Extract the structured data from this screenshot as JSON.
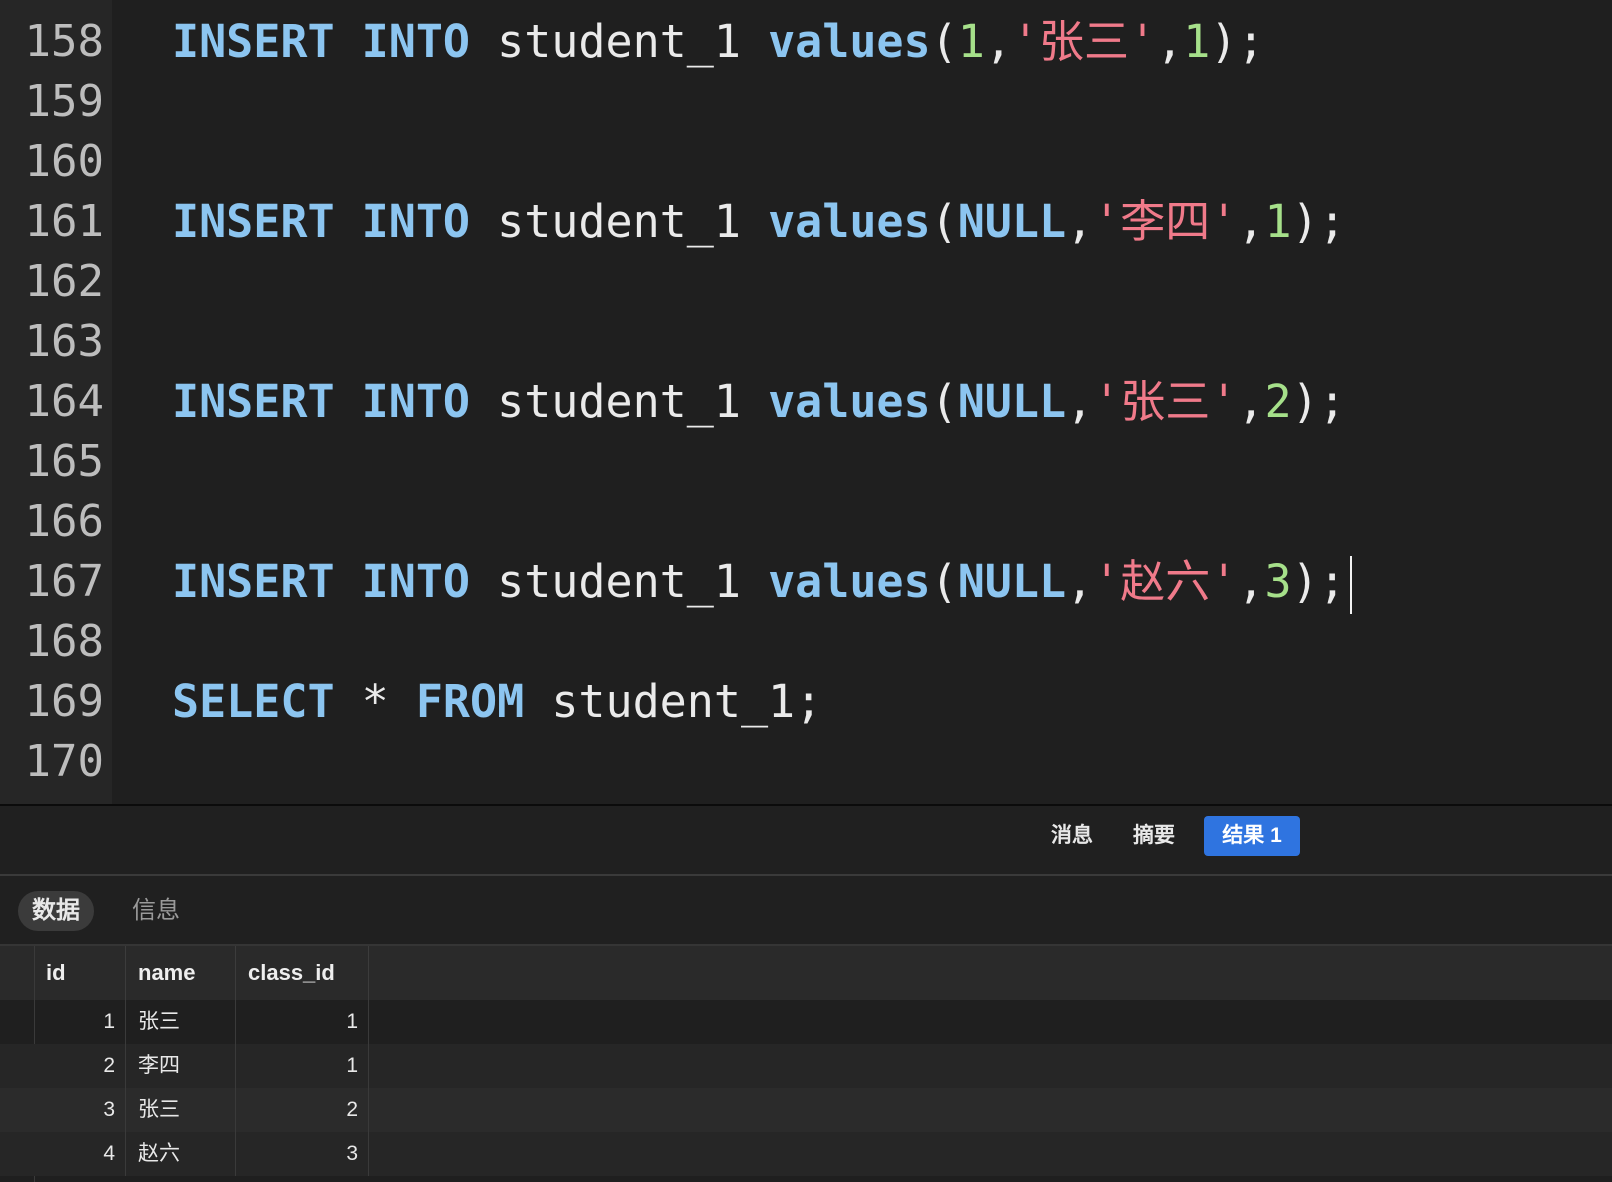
{
  "editor": {
    "lines": [
      {
        "no": "158",
        "tokens": [
          [
            "kw",
            "INSERT"
          ],
          [
            "punct",
            " "
          ],
          [
            "kw",
            "INTO"
          ],
          [
            "punct",
            " "
          ],
          [
            "ident",
            "student_1"
          ],
          [
            "punct",
            " "
          ],
          [
            "fn",
            "values"
          ],
          [
            "punct",
            "("
          ],
          [
            "num",
            "1"
          ],
          [
            "punct",
            ","
          ],
          [
            "str",
            "'张三'"
          ],
          [
            "punct",
            ","
          ],
          [
            "num",
            "1"
          ],
          [
            "punct",
            ");"
          ]
        ]
      },
      {
        "no": "159",
        "tokens": []
      },
      {
        "no": "160",
        "tokens": []
      },
      {
        "no": "161",
        "tokens": [
          [
            "kw",
            "INSERT"
          ],
          [
            "punct",
            " "
          ],
          [
            "kw",
            "INTO"
          ],
          [
            "punct",
            " "
          ],
          [
            "ident",
            "student_1"
          ],
          [
            "punct",
            " "
          ],
          [
            "fn",
            "values"
          ],
          [
            "punct",
            "("
          ],
          [
            "kw",
            "NULL"
          ],
          [
            "punct",
            ","
          ],
          [
            "str",
            "'李四'"
          ],
          [
            "punct",
            ","
          ],
          [
            "num",
            "1"
          ],
          [
            "punct",
            ");"
          ]
        ]
      },
      {
        "no": "162",
        "tokens": []
      },
      {
        "no": "163",
        "tokens": []
      },
      {
        "no": "164",
        "tokens": [
          [
            "kw",
            "INSERT"
          ],
          [
            "punct",
            " "
          ],
          [
            "kw",
            "INTO"
          ],
          [
            "punct",
            " "
          ],
          [
            "ident",
            "student_1"
          ],
          [
            "punct",
            " "
          ],
          [
            "fn",
            "values"
          ],
          [
            "punct",
            "("
          ],
          [
            "kw",
            "NULL"
          ],
          [
            "punct",
            ","
          ],
          [
            "str",
            "'张三'"
          ],
          [
            "punct",
            ","
          ],
          [
            "num",
            "2"
          ],
          [
            "punct",
            ");"
          ]
        ]
      },
      {
        "no": "165",
        "tokens": []
      },
      {
        "no": "166",
        "tokens": []
      },
      {
        "no": "167",
        "tokens": [
          [
            "kw",
            "INSERT"
          ],
          [
            "punct",
            " "
          ],
          [
            "kw",
            "INTO"
          ],
          [
            "punct",
            " "
          ],
          [
            "ident",
            "student_1"
          ],
          [
            "punct",
            " "
          ],
          [
            "fn",
            "values"
          ],
          [
            "punct",
            "("
          ],
          [
            "kw",
            "NULL"
          ],
          [
            "punct",
            ","
          ],
          [
            "str",
            "'赵六'"
          ],
          [
            "punct",
            ","
          ],
          [
            "num",
            "3"
          ],
          [
            "punct",
            ");"
          ]
        ],
        "caret": true
      },
      {
        "no": "168",
        "tokens": []
      },
      {
        "no": "169",
        "tokens": [
          [
            "kw",
            "SELECT"
          ],
          [
            "punct",
            " * "
          ],
          [
            "kw",
            "FROM"
          ],
          [
            "punct",
            " "
          ],
          [
            "ident",
            "student_1;"
          ]
        ]
      },
      {
        "no": "170",
        "tokens": []
      }
    ]
  },
  "result_tabs": {
    "messages": "消息",
    "summary": "摘要",
    "result1": "结果 1"
  },
  "sub_tabs": {
    "data": "数据",
    "info": "信息"
  },
  "table": {
    "columns": [
      "id",
      "name",
      "class_id"
    ],
    "rows": [
      {
        "id": "1",
        "name": "张三",
        "class_id": "1"
      },
      {
        "id": "2",
        "name": "李四",
        "class_id": "1"
      },
      {
        "id": "3",
        "name": "张三",
        "class_id": "2"
      },
      {
        "id": "4",
        "name": "赵六",
        "class_id": "3"
      }
    ]
  }
}
